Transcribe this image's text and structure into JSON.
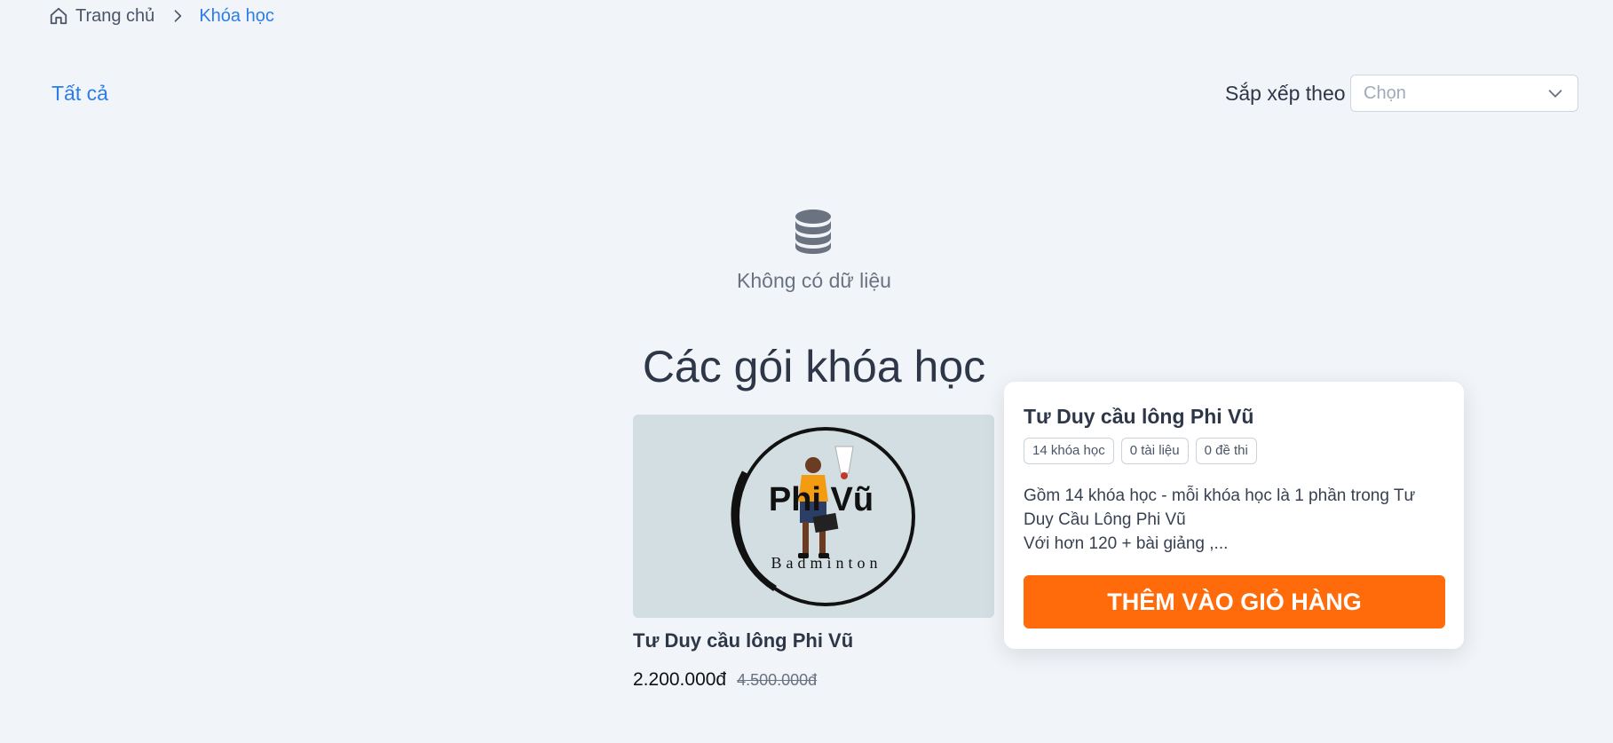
{
  "breadcrumb": {
    "home": "Trang chủ",
    "current": "Khóa học"
  },
  "filter": {
    "all_label": "Tất cả",
    "sort_label": "Sắp xếp theo",
    "sort_placeholder": "Chọn"
  },
  "empty_state": {
    "text": "Không có dữ liệu"
  },
  "section": {
    "title": "Các gói khóa học"
  },
  "course": {
    "name": "Tư Duy cầu lông Phi Vũ",
    "price": "2.200.000đ",
    "old_price": "4.500.000đ",
    "logo": {
      "title": "Phi Vũ",
      "subtitle": "Badminton"
    }
  },
  "popover": {
    "title": "Tư Duy cầu lông Phi Vũ",
    "badges": [
      "14 khóa học",
      "0 tài liệu",
      "0 đề thi"
    ],
    "description_lines": [
      "Gồm 14 khóa học - mỗi khóa học là 1 phần trong Tư",
      "Duy Cầu Lông Phi Vũ",
      "Với hơn 120 + bài giảng ,..."
    ],
    "button_label": "THÊM VÀO GIỎ HÀNG"
  },
  "colors": {
    "accent": "#2b7de9",
    "cta": "#ff6b0a",
    "background": "#f1f4f8"
  }
}
